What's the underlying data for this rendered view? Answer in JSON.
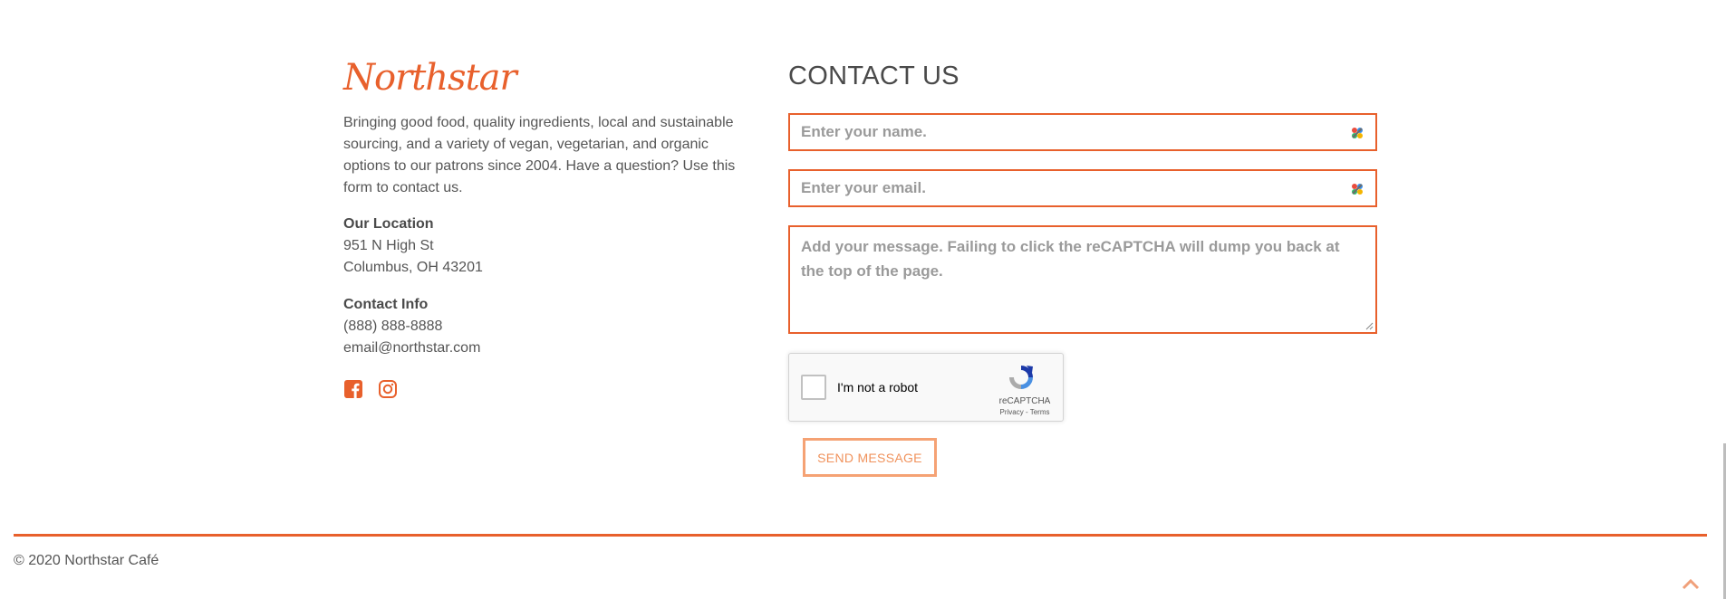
{
  "brand": {
    "name": "Northstar"
  },
  "intro": {
    "text": "Bringing good food, quality ingredients, local and sustainable sourcing, and a variety of vegan, vegetarian, and organic options to our patrons since 2004. Have a question? Use this form to contact us."
  },
  "location": {
    "heading": "Our Location",
    "line1": "951 N High St",
    "line2": "Columbus, OH 43201"
  },
  "contact_info": {
    "heading": "Contact Info",
    "phone": "(888) 888-8888",
    "email": "email@northstar.com"
  },
  "socials": [
    {
      "icon": "facebook-icon"
    },
    {
      "icon": "instagram-icon"
    }
  ],
  "form": {
    "title": "CONTACT US",
    "name_placeholder": "Enter your name.",
    "name_value": "",
    "email_placeholder": "Enter your email.",
    "email_value": "",
    "message_placeholder": "Add your message. Failing to click the reCAPTCHA will dump you back at the top of the page.",
    "message_value": "",
    "send_label": "SEND MESSAGE"
  },
  "recaptcha": {
    "label": "I'm not a robot",
    "brand": "reCAPTCHA",
    "terms": "Privacy - Terms"
  },
  "footer": {
    "copyright": "© 2020 Northstar Café"
  },
  "colors": {
    "accent": "#e8602c",
    "button_text": "#f0925c",
    "button_border": "#f5a274",
    "text": "#4a4a4a"
  }
}
